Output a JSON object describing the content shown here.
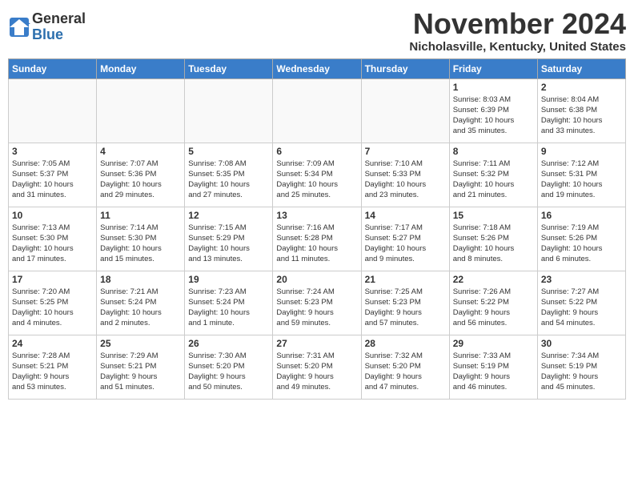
{
  "header": {
    "logo_general": "General",
    "logo_blue": "Blue",
    "month_title": "November 2024",
    "location": "Nicholasville, Kentucky, United States"
  },
  "weekdays": [
    "Sunday",
    "Monday",
    "Tuesday",
    "Wednesday",
    "Thursday",
    "Friday",
    "Saturday"
  ],
  "weeks": [
    [
      {
        "day": "",
        "info": ""
      },
      {
        "day": "",
        "info": ""
      },
      {
        "day": "",
        "info": ""
      },
      {
        "day": "",
        "info": ""
      },
      {
        "day": "",
        "info": ""
      },
      {
        "day": "1",
        "info": "Sunrise: 8:03 AM\nSunset: 6:39 PM\nDaylight: 10 hours\nand 35 minutes."
      },
      {
        "day": "2",
        "info": "Sunrise: 8:04 AM\nSunset: 6:38 PM\nDaylight: 10 hours\nand 33 minutes."
      }
    ],
    [
      {
        "day": "3",
        "info": "Sunrise: 7:05 AM\nSunset: 5:37 PM\nDaylight: 10 hours\nand 31 minutes."
      },
      {
        "day": "4",
        "info": "Sunrise: 7:07 AM\nSunset: 5:36 PM\nDaylight: 10 hours\nand 29 minutes."
      },
      {
        "day": "5",
        "info": "Sunrise: 7:08 AM\nSunset: 5:35 PM\nDaylight: 10 hours\nand 27 minutes."
      },
      {
        "day": "6",
        "info": "Sunrise: 7:09 AM\nSunset: 5:34 PM\nDaylight: 10 hours\nand 25 minutes."
      },
      {
        "day": "7",
        "info": "Sunrise: 7:10 AM\nSunset: 5:33 PM\nDaylight: 10 hours\nand 23 minutes."
      },
      {
        "day": "8",
        "info": "Sunrise: 7:11 AM\nSunset: 5:32 PM\nDaylight: 10 hours\nand 21 minutes."
      },
      {
        "day": "9",
        "info": "Sunrise: 7:12 AM\nSunset: 5:31 PM\nDaylight: 10 hours\nand 19 minutes."
      }
    ],
    [
      {
        "day": "10",
        "info": "Sunrise: 7:13 AM\nSunset: 5:30 PM\nDaylight: 10 hours\nand 17 minutes."
      },
      {
        "day": "11",
        "info": "Sunrise: 7:14 AM\nSunset: 5:30 PM\nDaylight: 10 hours\nand 15 minutes."
      },
      {
        "day": "12",
        "info": "Sunrise: 7:15 AM\nSunset: 5:29 PM\nDaylight: 10 hours\nand 13 minutes."
      },
      {
        "day": "13",
        "info": "Sunrise: 7:16 AM\nSunset: 5:28 PM\nDaylight: 10 hours\nand 11 minutes."
      },
      {
        "day": "14",
        "info": "Sunrise: 7:17 AM\nSunset: 5:27 PM\nDaylight: 10 hours\nand 9 minutes."
      },
      {
        "day": "15",
        "info": "Sunrise: 7:18 AM\nSunset: 5:26 PM\nDaylight: 10 hours\nand 8 minutes."
      },
      {
        "day": "16",
        "info": "Sunrise: 7:19 AM\nSunset: 5:26 PM\nDaylight: 10 hours\nand 6 minutes."
      }
    ],
    [
      {
        "day": "17",
        "info": "Sunrise: 7:20 AM\nSunset: 5:25 PM\nDaylight: 10 hours\nand 4 minutes."
      },
      {
        "day": "18",
        "info": "Sunrise: 7:21 AM\nSunset: 5:24 PM\nDaylight: 10 hours\nand 2 minutes."
      },
      {
        "day": "19",
        "info": "Sunrise: 7:23 AM\nSunset: 5:24 PM\nDaylight: 10 hours\nand 1 minute."
      },
      {
        "day": "20",
        "info": "Sunrise: 7:24 AM\nSunset: 5:23 PM\nDaylight: 9 hours\nand 59 minutes."
      },
      {
        "day": "21",
        "info": "Sunrise: 7:25 AM\nSunset: 5:23 PM\nDaylight: 9 hours\nand 57 minutes."
      },
      {
        "day": "22",
        "info": "Sunrise: 7:26 AM\nSunset: 5:22 PM\nDaylight: 9 hours\nand 56 minutes."
      },
      {
        "day": "23",
        "info": "Sunrise: 7:27 AM\nSunset: 5:22 PM\nDaylight: 9 hours\nand 54 minutes."
      }
    ],
    [
      {
        "day": "24",
        "info": "Sunrise: 7:28 AM\nSunset: 5:21 PM\nDaylight: 9 hours\nand 53 minutes."
      },
      {
        "day": "25",
        "info": "Sunrise: 7:29 AM\nSunset: 5:21 PM\nDaylight: 9 hours\nand 51 minutes."
      },
      {
        "day": "26",
        "info": "Sunrise: 7:30 AM\nSunset: 5:20 PM\nDaylight: 9 hours\nand 50 minutes."
      },
      {
        "day": "27",
        "info": "Sunrise: 7:31 AM\nSunset: 5:20 PM\nDaylight: 9 hours\nand 49 minutes."
      },
      {
        "day": "28",
        "info": "Sunrise: 7:32 AM\nSunset: 5:20 PM\nDaylight: 9 hours\nand 47 minutes."
      },
      {
        "day": "29",
        "info": "Sunrise: 7:33 AM\nSunset: 5:19 PM\nDaylight: 9 hours\nand 46 minutes."
      },
      {
        "day": "30",
        "info": "Sunrise: 7:34 AM\nSunset: 5:19 PM\nDaylight: 9 hours\nand 45 minutes."
      }
    ]
  ]
}
